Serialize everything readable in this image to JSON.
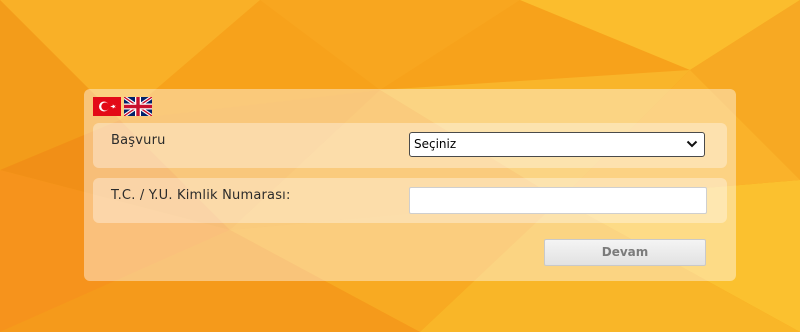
{
  "languages": [
    {
      "code": "tr",
      "icon": "turkey-flag-icon"
    },
    {
      "code": "en",
      "icon": "uk-flag-icon"
    }
  ],
  "form": {
    "application": {
      "label": "Başvuru",
      "selected": "Seçiniz"
    },
    "id_number": {
      "label": "T.C. / Y.U. Kimlik Numarası:",
      "value": "",
      "placeholder": ""
    },
    "continue_label": "Devam"
  },
  "colors": {
    "background_accent": "#f7a21b",
    "turkey_red": "#e30a17"
  }
}
